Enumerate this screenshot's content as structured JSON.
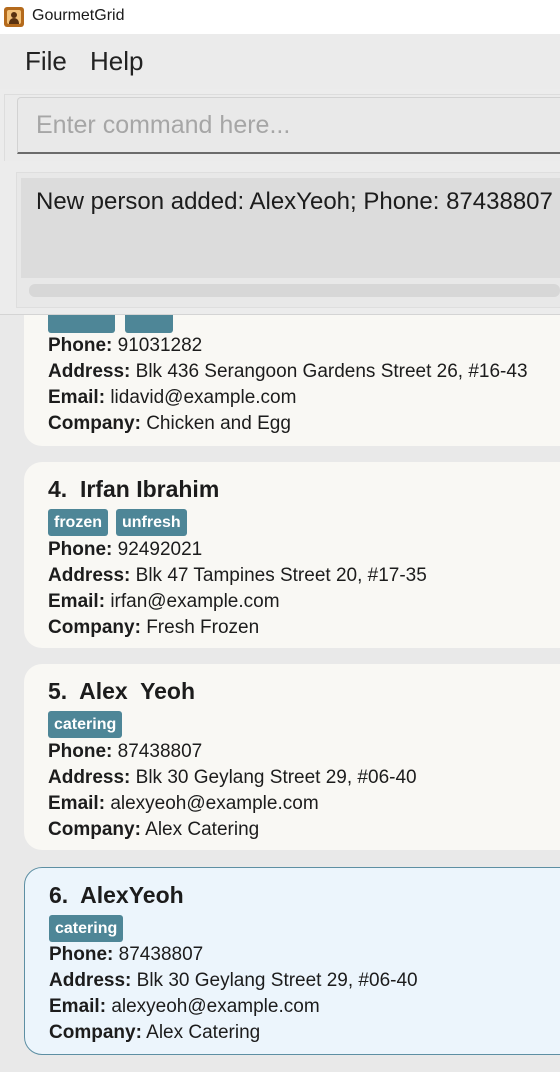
{
  "window": {
    "title": "GourmetGrid",
    "icon": "app-icon"
  },
  "menu": {
    "file": "File",
    "help": "Help"
  },
  "command": {
    "value": "",
    "placeholder": "Enter command here..."
  },
  "result": {
    "text": "New person added: AlexYeoh; Phone: 87438807"
  },
  "labels": {
    "phone": "Phone:",
    "address": "Address:",
    "email": "Email:",
    "company": "Company:"
  },
  "colors": {
    "tag": "#4e8697",
    "selected_border": "#5d8fa3",
    "selected_bg": "#ecf5fc"
  },
  "persons": [
    {
      "phone": "91031282",
      "address": "Blk 436 Serangoon Gardens Street 26, #16-43",
      "email": "lidavid@example.com",
      "company": "Chicken and Egg"
    },
    {
      "index": "4.",
      "name": "Irfan Ibrahim",
      "tags": [
        "frozen",
        "unfresh"
      ],
      "phone": "92492021",
      "address": "Blk 47 Tampines Street 20, #17-35",
      "email": "irfan@example.com",
      "company": "Fresh Frozen"
    },
    {
      "index": "5.",
      "name": "Alex  Yeoh",
      "tags": [
        "catering"
      ],
      "phone": "87438807",
      "address": "Blk 30 Geylang Street 29, #06-40",
      "email": "alexyeoh@example.com",
      "company": "Alex Catering"
    },
    {
      "index": "6.",
      "name": "AlexYeoh",
      "tags": [
        "catering"
      ],
      "phone": "87438807",
      "address": "Blk 30 Geylang Street 29, #06-40",
      "email": "alexyeoh@example.com",
      "company": "Alex Catering",
      "selected": true
    }
  ]
}
